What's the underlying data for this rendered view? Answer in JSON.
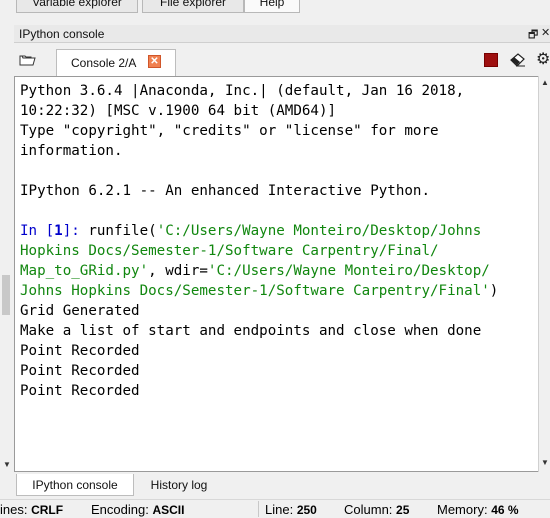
{
  "top_tabs": [
    {
      "label": "Variable explorer"
    },
    {
      "label": "File explorer"
    },
    {
      "label": "Help"
    }
  ],
  "pane": {
    "title": "IPython console",
    "undock_glyph": "🗗",
    "close_glyph": "✕"
  },
  "console_tab": {
    "label": "Console 2/A",
    "close_glyph": "✕"
  },
  "console": {
    "banner": [
      "Python 3.6.4 |Anaconda, Inc.| (default, Jan 16 2018,",
      "10:22:32) [MSC v.1900 64 bit (AMD64)]",
      "Type \"copyright\", \"credits\" or \"license\" for more",
      "information.",
      "",
      "IPython 6.2.1 -- An enhanced Interactive Python.",
      ""
    ],
    "prompt_prefix": "In [",
    "prompt_number": "1",
    "prompt_suffix": "]: ",
    "cmd_func": "runfile(",
    "cmd_path_line1": "'C:/Users/Wayne Monteiro/Desktop/Johns",
    "cmd_path_line2": "Hopkins Docs/Semester-1/Software Carpentry/Final/",
    "cmd_path_line3": "Map_to_GRid.py'",
    "cmd_wdir": ", wdir=",
    "cmd_wdir_line3": "'C:/Users/Wayne Monteiro/Desktop/",
    "cmd_wdir_line4": "Johns Hopkins Docs/Semester-1/Software Carpentry/Final'",
    "cmd_close": ")",
    "output": [
      "Grid Generated",
      "Make a list of start and endpoints and close when done",
      "Point Recorded",
      "Point Recorded",
      "Point Recorded"
    ]
  },
  "bottom_tabs": [
    {
      "label": "IPython console"
    },
    {
      "label": "History log"
    }
  ],
  "status": {
    "eol_label": "ines:",
    "eol_value": "CRLF",
    "encoding_label": "Encoding:",
    "encoding_value": "ASCII",
    "line_label": "Line:",
    "line_value": "250",
    "column_label": "Column:",
    "column_value": "25",
    "memory_label": "Memory:",
    "memory_value": "46 %"
  },
  "colors": {
    "prompt": "#0000cc",
    "string": "#11870f",
    "stop": "#9e1010",
    "close_badge": "#f08050"
  }
}
